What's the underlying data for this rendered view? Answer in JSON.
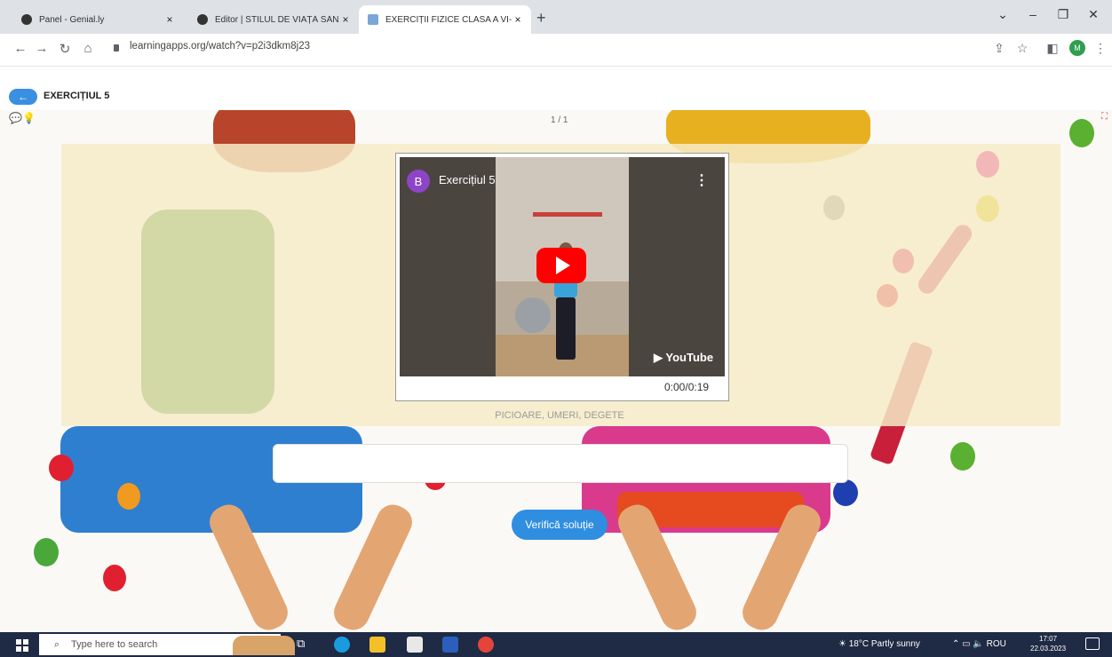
{
  "browser": {
    "tabs": [
      {
        "title": "Panel - Genial.ly",
        "close": "×"
      },
      {
        "title": "Editor | STILUL DE VIAȚĂ SĂNĂT...",
        "close": "×"
      },
      {
        "title": "EXERCIȚII FIZICE CLASA A VI-A D",
        "close": "×"
      }
    ],
    "new_tab": "+",
    "url": "learningapps.org/watch?v=p2i3dkm8j23",
    "window_controls": {
      "minimize": "–",
      "maximize": "❐",
      "close": "✕",
      "tab_search": "⌄"
    },
    "profile_initial": "M"
  },
  "app": {
    "title": "EXERCIȚIUL 5",
    "counter": "1 / 1",
    "video": {
      "channel_initial": "B",
      "title": "Exercițiul 5",
      "time": "0:00/0:19",
      "logo": "YouTube"
    },
    "caption": "PICIOARE, UMERI, DEGETE",
    "answer_value": "",
    "check_button": "Verifică soluție"
  },
  "taskbar": {
    "search_placeholder": "Type here to search",
    "weather": "18°C Partly sunny",
    "language": "ROU",
    "time": "17:07",
    "date": "22.03.2023"
  },
  "colors": {
    "accent": "#2f8ee0",
    "band": "#f6ecc8",
    "taskbar": "#1f2a44"
  }
}
